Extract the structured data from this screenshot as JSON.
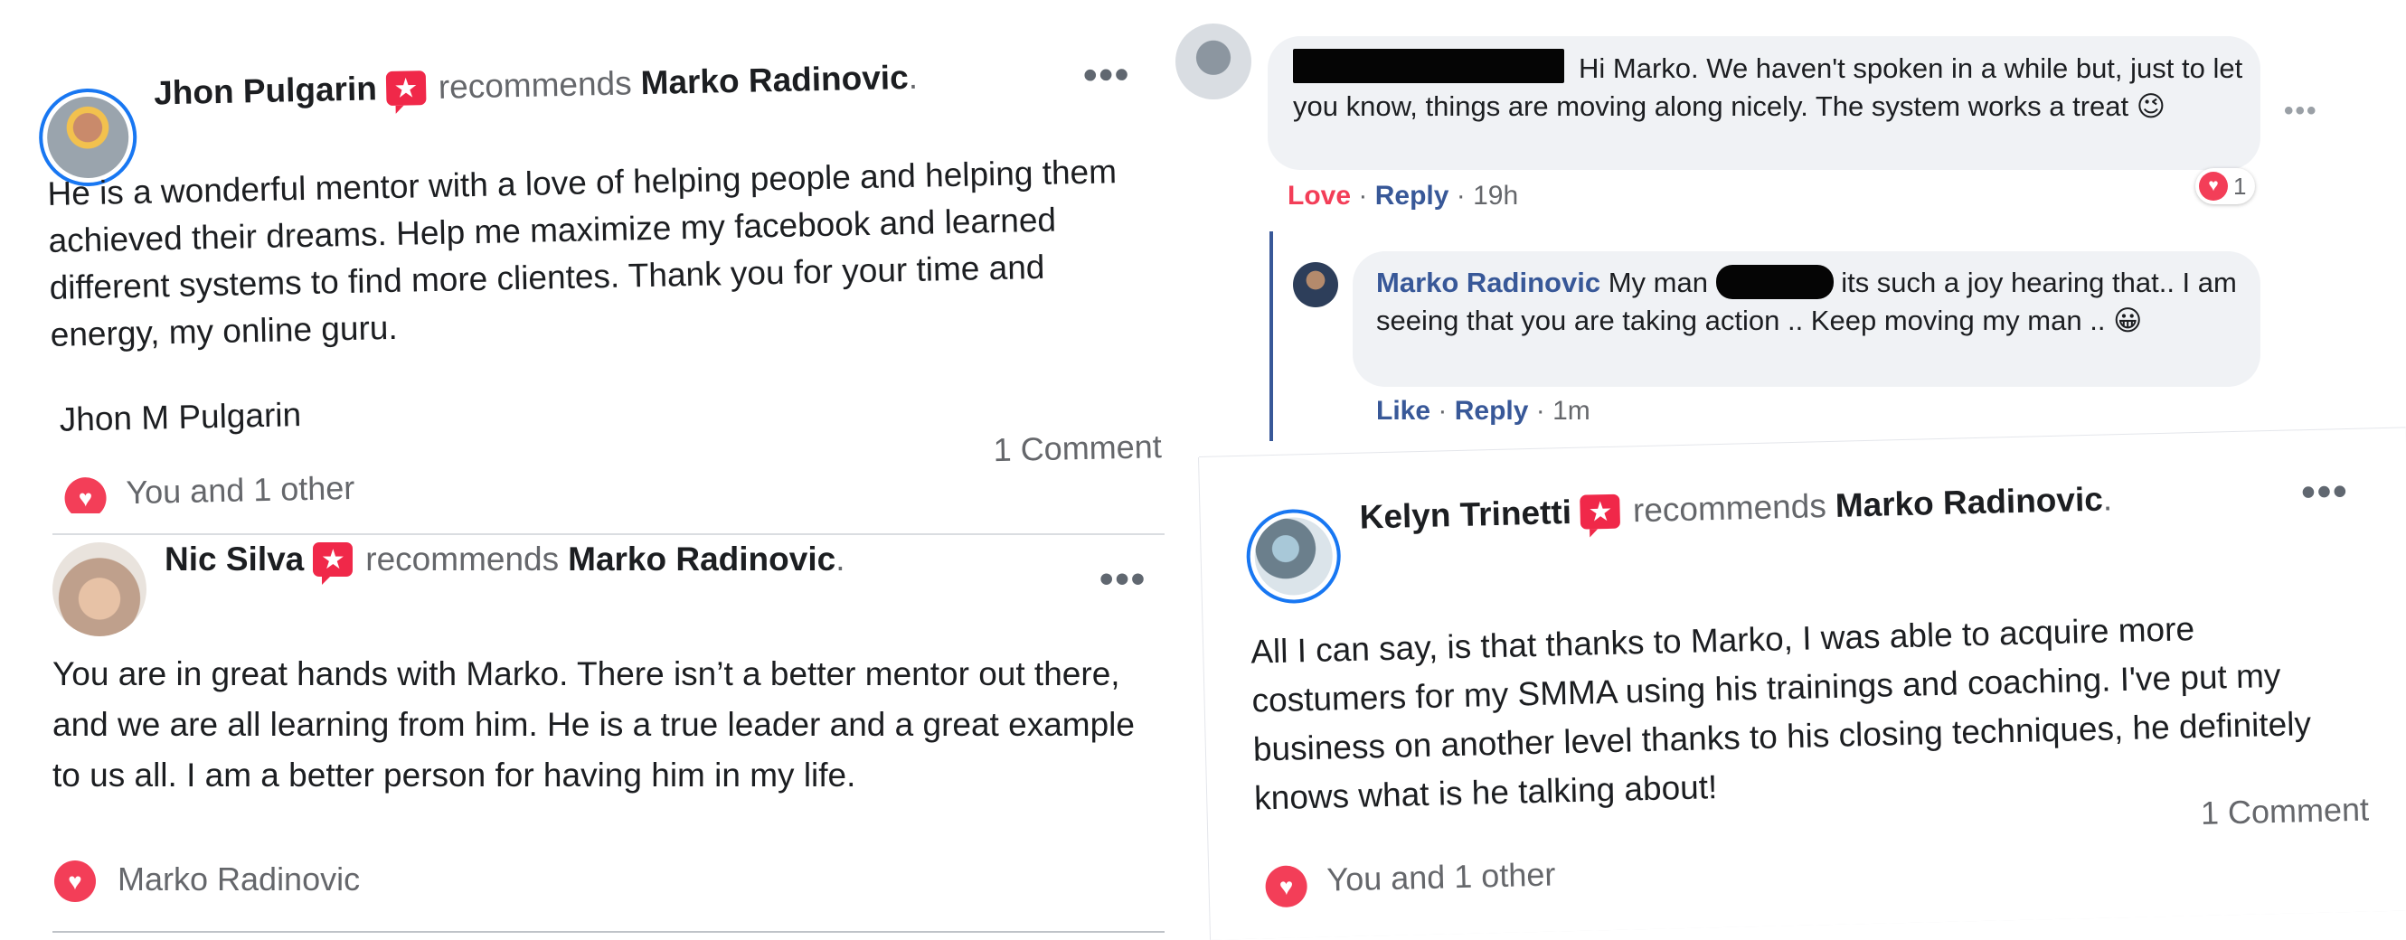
{
  "colors": {
    "accent": "#1877f2",
    "love": "#f33e58",
    "link": "#385898"
  },
  "post1": {
    "author": "Jhon Pulgarin",
    "recommends_text": "recommends",
    "page_name": "Marko Radinovic",
    "period": ".",
    "menu": "•••",
    "body": "He is a wonderful mentor with a love of helping people and helping them achieved their dreams. Help me maximize my facebook and learned different systems to find more clientes. Thank you for your time and energy, my online guru.",
    "signature": "Jhon M Pulgarin",
    "reactions": "You and 1 other",
    "comments": "1 Comment"
  },
  "post2": {
    "author": "Nic Silva",
    "recommends_text": "recommends",
    "page_name": "Marko Radinovic",
    "period": ".",
    "menu": "•••",
    "body": "You are in great hands with Marko. There isn’t a better mentor out there, and we are all learning from him. He is a true leader and a great example to us all. I am a better person for having him in my life.",
    "reactions": "Marko Radinovic"
  },
  "thread": {
    "comment1": {
      "text": "Hi Marko. We haven't spoken in a while but, just to let you know, things are moving along nicely. The system works a treat",
      "emoji": "😉",
      "reacted_label": "Love",
      "reply_label": "Reply",
      "time": "19h",
      "reaction_count": "1",
      "menu": "•••"
    },
    "reply1": {
      "author": "Marko Radinovic",
      "text_before": "My man",
      "text_after": "its such a joy hearing that.. I am seeing that you are taking action .. Keep moving my man ..",
      "emoji": "😀",
      "like_label": "Like",
      "reply_label": "Reply",
      "time": "1m"
    },
    "separator": "·"
  },
  "post3": {
    "author": "Kelyn Trinetti",
    "recommends_text": "recommends",
    "page_name": "Marko Radinovic",
    "period": ".",
    "menu": "•••",
    "body": "All I can say, is that thanks to Marko, I was able to acquire more costumers for my SMMA using his trainings and coaching. I've put my business on another level thanks to his closing techniques, he definitely knows what is he talking about!",
    "reactions": "You and 1 other",
    "comments": "1 Comment"
  }
}
